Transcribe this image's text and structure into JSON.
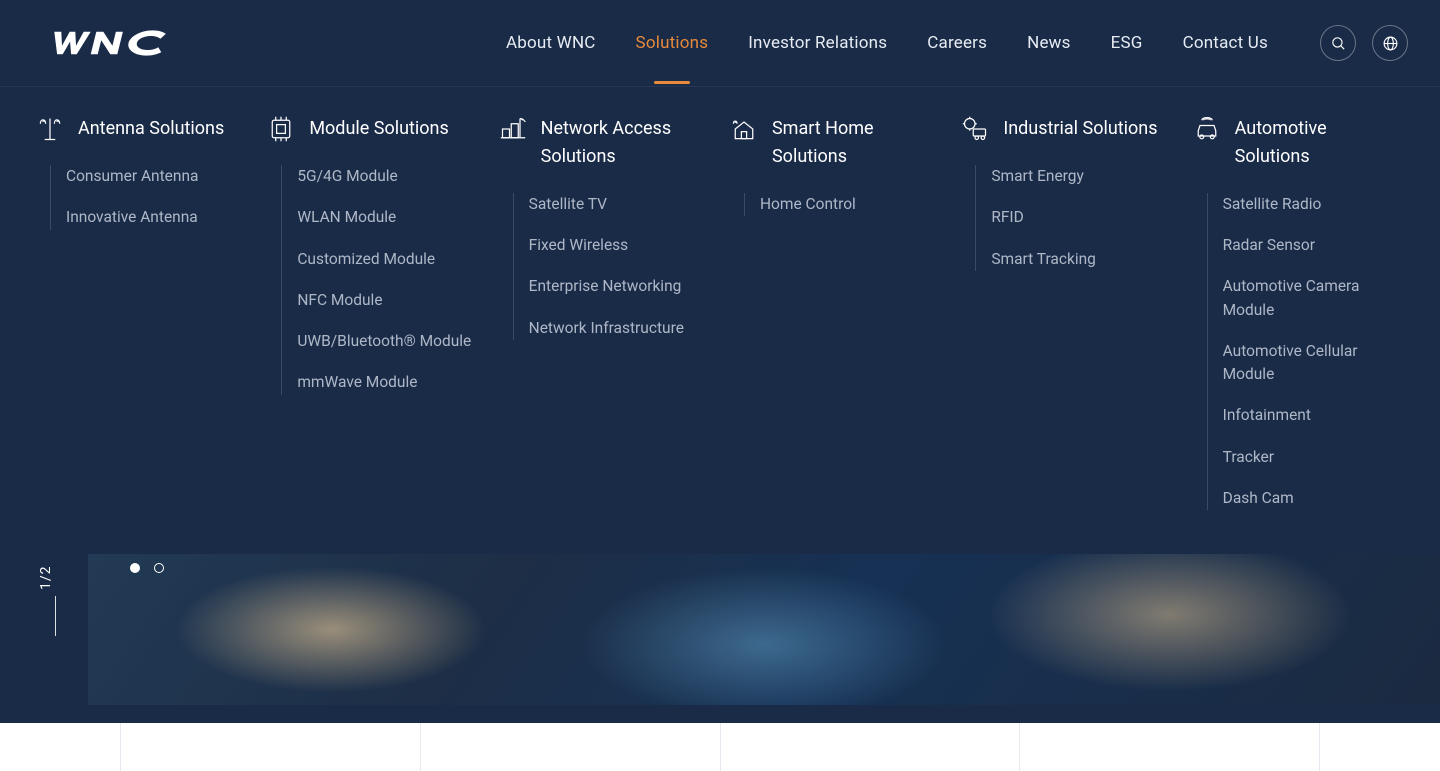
{
  "brand": {
    "name": "WNC"
  },
  "nav": {
    "items": [
      {
        "label": "About WNC"
      },
      {
        "label": "Solutions"
      },
      {
        "label": "Investor Relations"
      },
      {
        "label": "Careers"
      },
      {
        "label": "News"
      },
      {
        "label": "ESG"
      },
      {
        "label": "Contact Us"
      }
    ],
    "active_index": 1
  },
  "mega": {
    "columns": [
      {
        "title": "Antenna Solutions",
        "icon": "antenna-icon",
        "items": [
          "Consumer Antenna",
          "Innovative Antenna"
        ]
      },
      {
        "title": "Module Solutions",
        "icon": "module-icon",
        "items": [
          "5G/4G Module",
          "WLAN Module",
          "Customized Module",
          "NFC Module",
          "UWB/Bluetooth® Module",
          "mmWave Module"
        ]
      },
      {
        "title": "Network Access Solutions",
        "icon": "network-icon",
        "items": [
          "Satellite TV",
          "Fixed Wireless",
          "Enterprise Networking",
          "Network Infrastructure"
        ]
      },
      {
        "title": "Smart Home Solutions",
        "icon": "home-icon",
        "items": [
          "Home Control"
        ]
      },
      {
        "title": "Industrial Solutions",
        "icon": "industrial-icon",
        "items": [
          "Smart Energy",
          "RFID",
          "Smart Tracking"
        ]
      },
      {
        "title": "Automotive Solutions",
        "icon": "automotive-icon",
        "items": [
          "Satellite Radio",
          "Radar Sensor",
          "Automotive Camera Module",
          "Automotive Cellular Module",
          "Infotainment",
          "Tracker",
          "Dash Cam"
        ]
      }
    ]
  },
  "hero": {
    "page_current": "1",
    "page_sep": "/",
    "page_total": "2",
    "dots": 2,
    "active_dot": 0
  },
  "colors": {
    "bg": "#1A2B48",
    "accent": "#E88A3A",
    "text": "#E7ECF3",
    "muted": "#AEB7C6"
  }
}
